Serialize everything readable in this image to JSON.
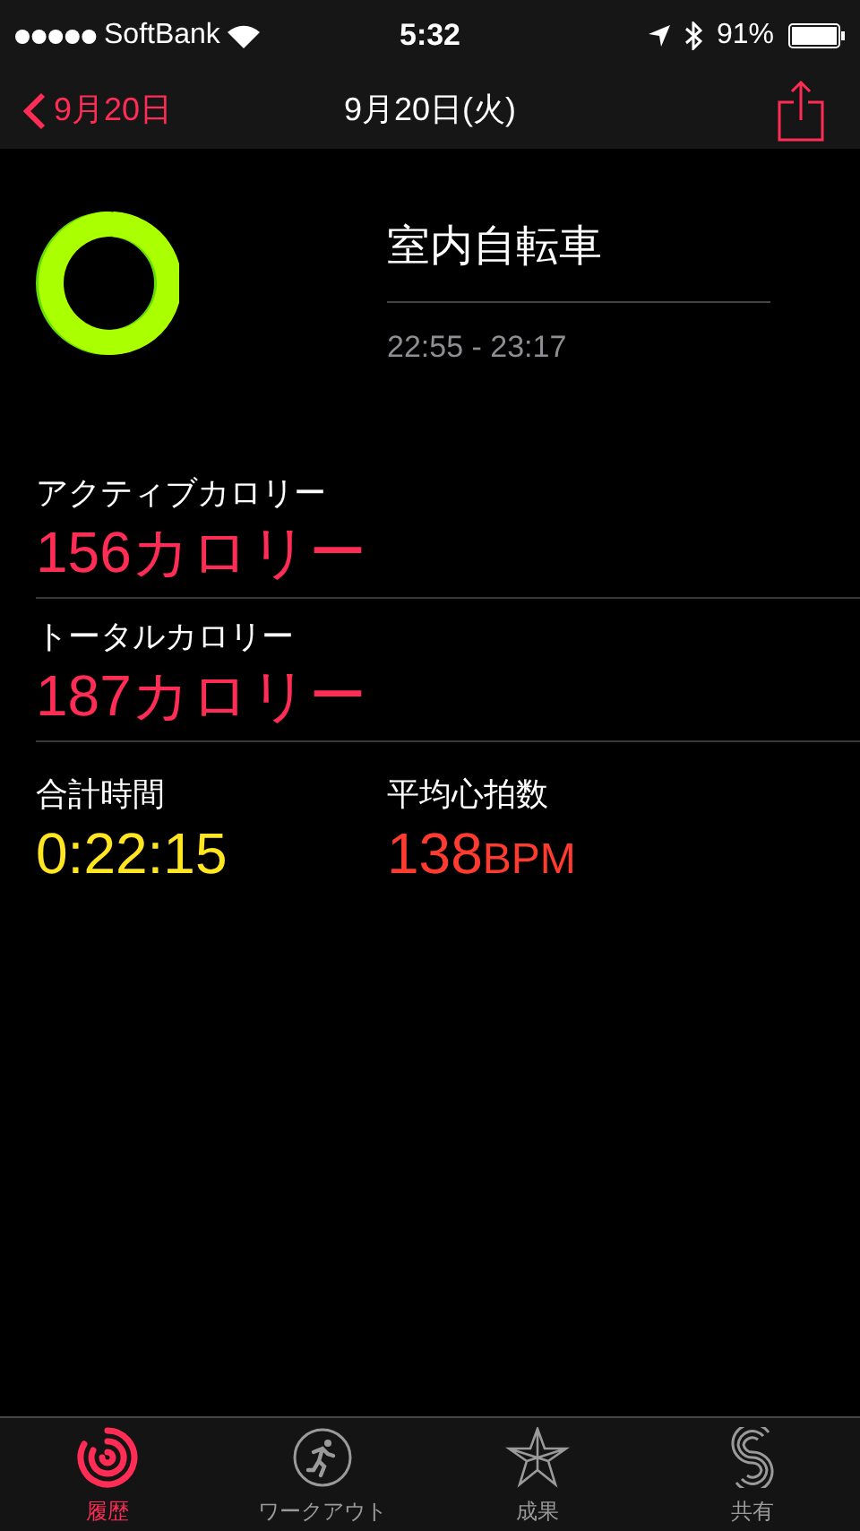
{
  "status_bar": {
    "carrier": "SoftBank",
    "time": "5:32",
    "battery": "91%"
  },
  "nav": {
    "back": "9月20日",
    "title": "9月20日(火)"
  },
  "workout": {
    "name": "室内自転車",
    "time_range": "22:55 - 23:17"
  },
  "metrics": [
    {
      "label": "アクティブカロリー",
      "value": "156カロリー",
      "color": "#ff2d55"
    },
    {
      "label": "トータルカロリー",
      "value": "187カロリー",
      "color": "#ff2d55"
    }
  ],
  "stats": [
    {
      "label": "合計時間",
      "value": "0:22:15",
      "color": "#ffe620"
    },
    {
      "label": "平均心拍数",
      "value": "138",
      "unit": "BPM",
      "color": "#ff3b30"
    }
  ],
  "tabs": [
    {
      "label": "履歴",
      "kind": "history",
      "selected": true
    },
    {
      "label": "ワークアウト",
      "kind": "workout",
      "selected": false
    },
    {
      "label": "成果",
      "kind": "awards",
      "selected": false
    },
    {
      "label": "共有",
      "kind": "sharing",
      "selected": false
    }
  ]
}
